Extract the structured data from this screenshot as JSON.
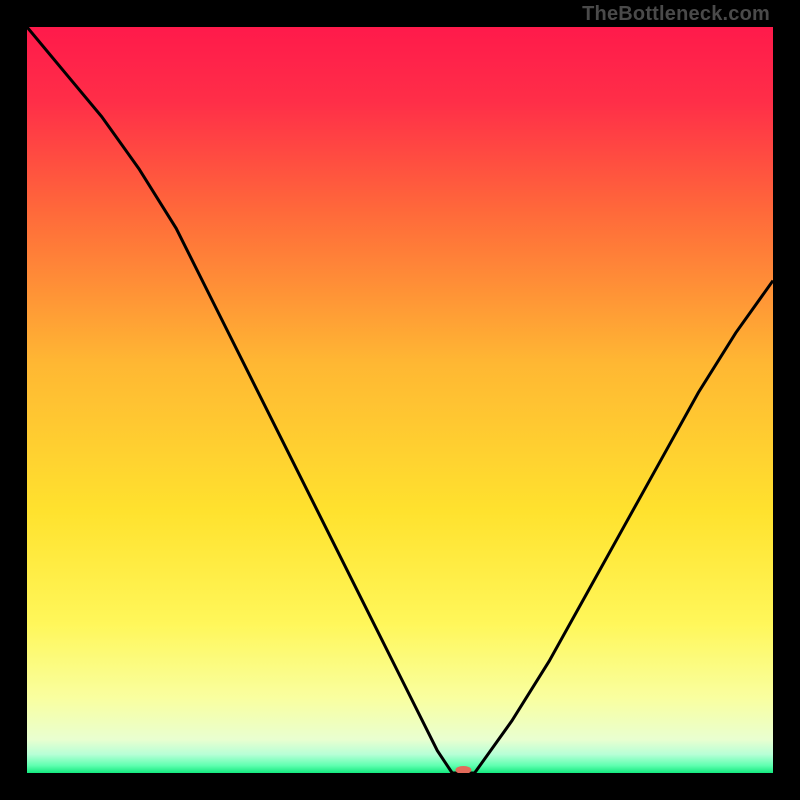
{
  "watermark": "TheBottleneck.com",
  "chart_data": {
    "type": "line",
    "title": "",
    "xlabel": "",
    "ylabel": "",
    "xlim": [
      0,
      100
    ],
    "ylim": [
      0,
      100
    ],
    "x": [
      0,
      5,
      10,
      15,
      20,
      25,
      30,
      35,
      40,
      45,
      50,
      55,
      57,
      60,
      65,
      70,
      75,
      80,
      85,
      90,
      95,
      100
    ],
    "values": [
      100,
      94,
      88,
      81,
      73,
      63,
      53,
      43,
      33,
      23,
      13,
      3,
      0,
      0,
      7,
      15,
      24,
      33,
      42,
      51,
      59,
      66
    ],
    "marker": {
      "x": 58.5,
      "y": 0,
      "color": "#e26a5a",
      "rx": 8,
      "ry": 4
    },
    "annotations": []
  },
  "gradient_stops": [
    {
      "offset": 0.0,
      "color": "#ff1a4b"
    },
    {
      "offset": 0.1,
      "color": "#ff2e48"
    },
    {
      "offset": 0.25,
      "color": "#ff6a3a"
    },
    {
      "offset": 0.45,
      "color": "#ffb733"
    },
    {
      "offset": 0.65,
      "color": "#ffe22e"
    },
    {
      "offset": 0.8,
      "color": "#fff75a"
    },
    {
      "offset": 0.9,
      "color": "#f9ffa0"
    },
    {
      "offset": 0.955,
      "color": "#e9ffd0"
    },
    {
      "offset": 0.975,
      "color": "#b7ffd6"
    },
    {
      "offset": 0.99,
      "color": "#5fffb0"
    },
    {
      "offset": 1.0,
      "color": "#13e97e"
    }
  ]
}
